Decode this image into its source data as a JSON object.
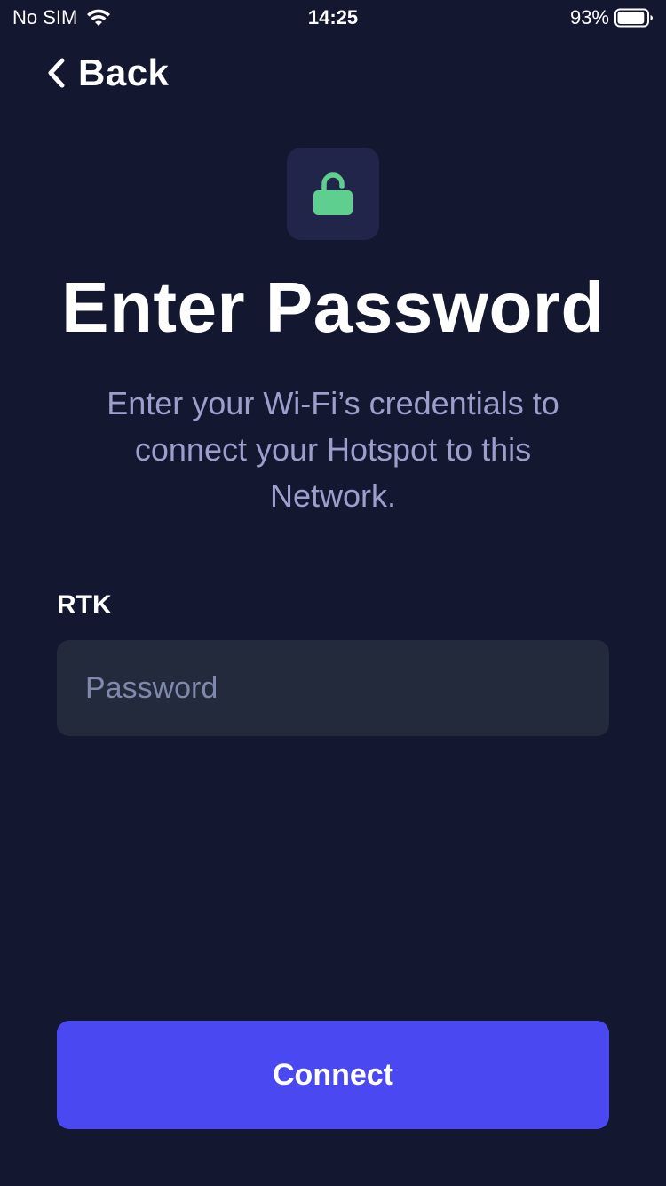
{
  "status_bar": {
    "carrier": "No SIM",
    "time": "14:25",
    "battery_percent": "93%",
    "battery_level": 0.93,
    "icons": [
      "wifi-icon",
      "battery-icon"
    ]
  },
  "nav": {
    "back_label": "Back",
    "back_icon": "chevron-left-icon"
  },
  "header": {
    "icon": "lock-open-icon",
    "icon_color": "#5fcf8f",
    "title": "Enter Password",
    "subtitle": "Enter your Wi-Fi’s credentials to connect your Hotspot to this Network."
  },
  "form": {
    "network_name": "RTK",
    "password_value": "",
    "password_placeholder": "Password"
  },
  "actions": {
    "connect_label": "Connect",
    "accent_color": "#4a49f1"
  }
}
